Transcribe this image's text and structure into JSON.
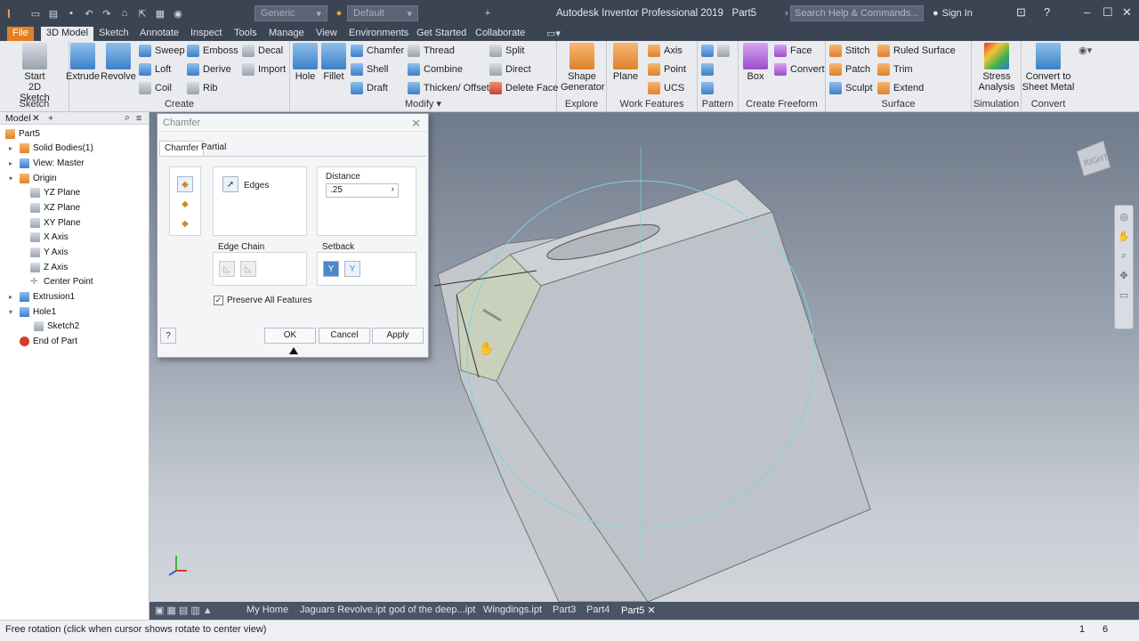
{
  "window": {
    "title": "Autodesk Inventor Professional 2019",
    "doc": "Part5",
    "search_placeholder": "Search Help & Commands...",
    "signin": "Sign In",
    "material": "Generic",
    "appearance": "Default"
  },
  "menu": [
    "File",
    "3D Model",
    "Sketch",
    "Annotate",
    "Inspect",
    "Tools",
    "Manage",
    "View",
    "Environments",
    "Get Started",
    "Collaborate"
  ],
  "ribbon": {
    "sketch": {
      "start_line1": "Start",
      "start_line2": "2D Sketch",
      "label": "Sketch"
    },
    "create": {
      "extrude": "Extrude",
      "revolve": "Revolve",
      "sweep": "Sweep",
      "emboss": "Emboss",
      "decal": "Decal",
      "loft": "Loft",
      "derive": "Derive",
      "import": "Import",
      "coil": "Coil",
      "rib": "Rib",
      "label": "Create"
    },
    "modify": {
      "hole": "Hole",
      "fillet": "Fillet",
      "chamfer": "Chamfer",
      "thread": "Thread",
      "split": "Split",
      "shell": "Shell",
      "combine": "Combine",
      "direct": "Direct",
      "draft": "Draft",
      "thicken": "Thicken/ Offset",
      "delete_face": "Delete Face",
      "label": "Modify"
    },
    "explore": {
      "shape_line1": "Shape",
      "shape_line2": "Generator",
      "label": "Explore"
    },
    "work": {
      "plane": "Plane",
      "axis": "Axis",
      "point": "Point",
      "ucs": "UCS",
      "label": "Work Features"
    },
    "pattern": {
      "label": "Pattern"
    },
    "freeform": {
      "box": "Box",
      "face": "Face",
      "convert": "Convert",
      "label": "Create Freeform"
    },
    "surface": {
      "stitch": "Stitch",
      "ruled": "Ruled Surface",
      "patch": "Patch",
      "trim": "Trim",
      "sculpt": "Sculpt",
      "extend": "Extend",
      "label": "Surface"
    },
    "simulation": {
      "line1": "Stress",
      "line2": "Analysis",
      "label": "Simulation"
    },
    "convert": {
      "line1": "Convert to",
      "line2": "Sheet Metal",
      "label": "Convert"
    }
  },
  "browser": {
    "tab": "Model",
    "items": [
      {
        "label": "Part5"
      },
      {
        "label": "Solid Bodies(1)"
      },
      {
        "label": "View: Master"
      },
      {
        "label": "Origin"
      },
      {
        "label": "YZ Plane"
      },
      {
        "label": "XZ Plane"
      },
      {
        "label": "XY Plane"
      },
      {
        "label": "X Axis"
      },
      {
        "label": "Y Axis"
      },
      {
        "label": "Z Axis"
      },
      {
        "label": "Center Point"
      },
      {
        "label": "Extrusion1"
      },
      {
        "label": "Hole1"
      },
      {
        "label": "Sketch2"
      },
      {
        "label": "End of Part"
      }
    ]
  },
  "dialog": {
    "title": "Chamfer",
    "tabs": [
      "Chamfer",
      "Partial"
    ],
    "edges_label": "Edges",
    "distance_label": "Distance",
    "distance_value": ".25",
    "edge_chain_label": "Edge Chain",
    "setback_label": "Setback",
    "preserve_label": "Preserve All Features",
    "ok": "OK",
    "cancel": "Cancel",
    "apply": "Apply"
  },
  "viewcube_label": "RIGHT",
  "doc_tabs": [
    "My Home",
    "Jaguars Revolve.ipt",
    "god of the deep...ipt",
    "Wingdings.ipt",
    "Part3",
    "Part4",
    "Part5"
  ],
  "status": {
    "text": "Free rotation (click when cursor shows rotate to center view)",
    "n1": "1",
    "n2": "6"
  }
}
